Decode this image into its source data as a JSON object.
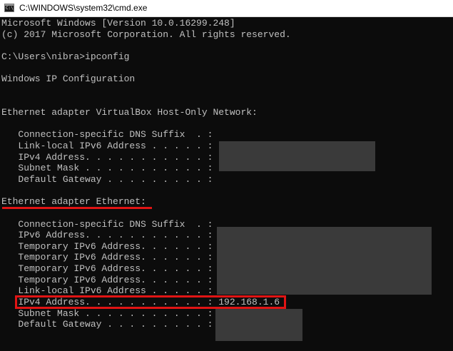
{
  "window": {
    "title": "C:\\WINDOWS\\system32\\cmd.exe",
    "icon": "console-window-icon",
    "icon_glyph": "C:\\"
  },
  "console": {
    "lines": [
      "Microsoft Windows [Version 10.0.16299.248]",
      "(c) 2017 Microsoft Corporation. All rights reserved.",
      "",
      "C:\\Users\\nibra>ipconfig",
      "",
      "Windows IP Configuration",
      "",
      "",
      "Ethernet adapter VirtualBox Host-Only Network:",
      "",
      "   Connection-specific DNS Suffix  . :",
      "   Link-local IPv6 Address . . . . . :",
      "   IPv4 Address. . . . . . . . . . . :",
      "   Subnet Mask . . . . . . . . . . . :",
      "   Default Gateway . . . . . . . . . :",
      "",
      "Ethernet adapter Ethernet:",
      "",
      "   Connection-specific DNS Suffix  . :",
      "   IPv6 Address. . . . . . . . . . . :",
      "   Temporary IPv6 Address. . . . . . :",
      "   Temporary IPv6 Address. . . . . . :",
      "   Temporary IPv6 Address. . . . . . :",
      "   Temporary IPv6 Address. . . . . . :",
      "   Link-local IPv6 Address . . . . . :",
      "   IPv4 Address. . . . . . . . . . . : 192.168.1.6",
      "   Subnet Mask . . . . . . . . . . . :",
      "   Default Gateway . . . . . . . . . :"
    ]
  },
  "colors": {
    "console_bg": "#0c0c0c",
    "console_fg": "#c0c0c0",
    "highlight": "#e01414",
    "redaction": "#3a3a3a"
  }
}
